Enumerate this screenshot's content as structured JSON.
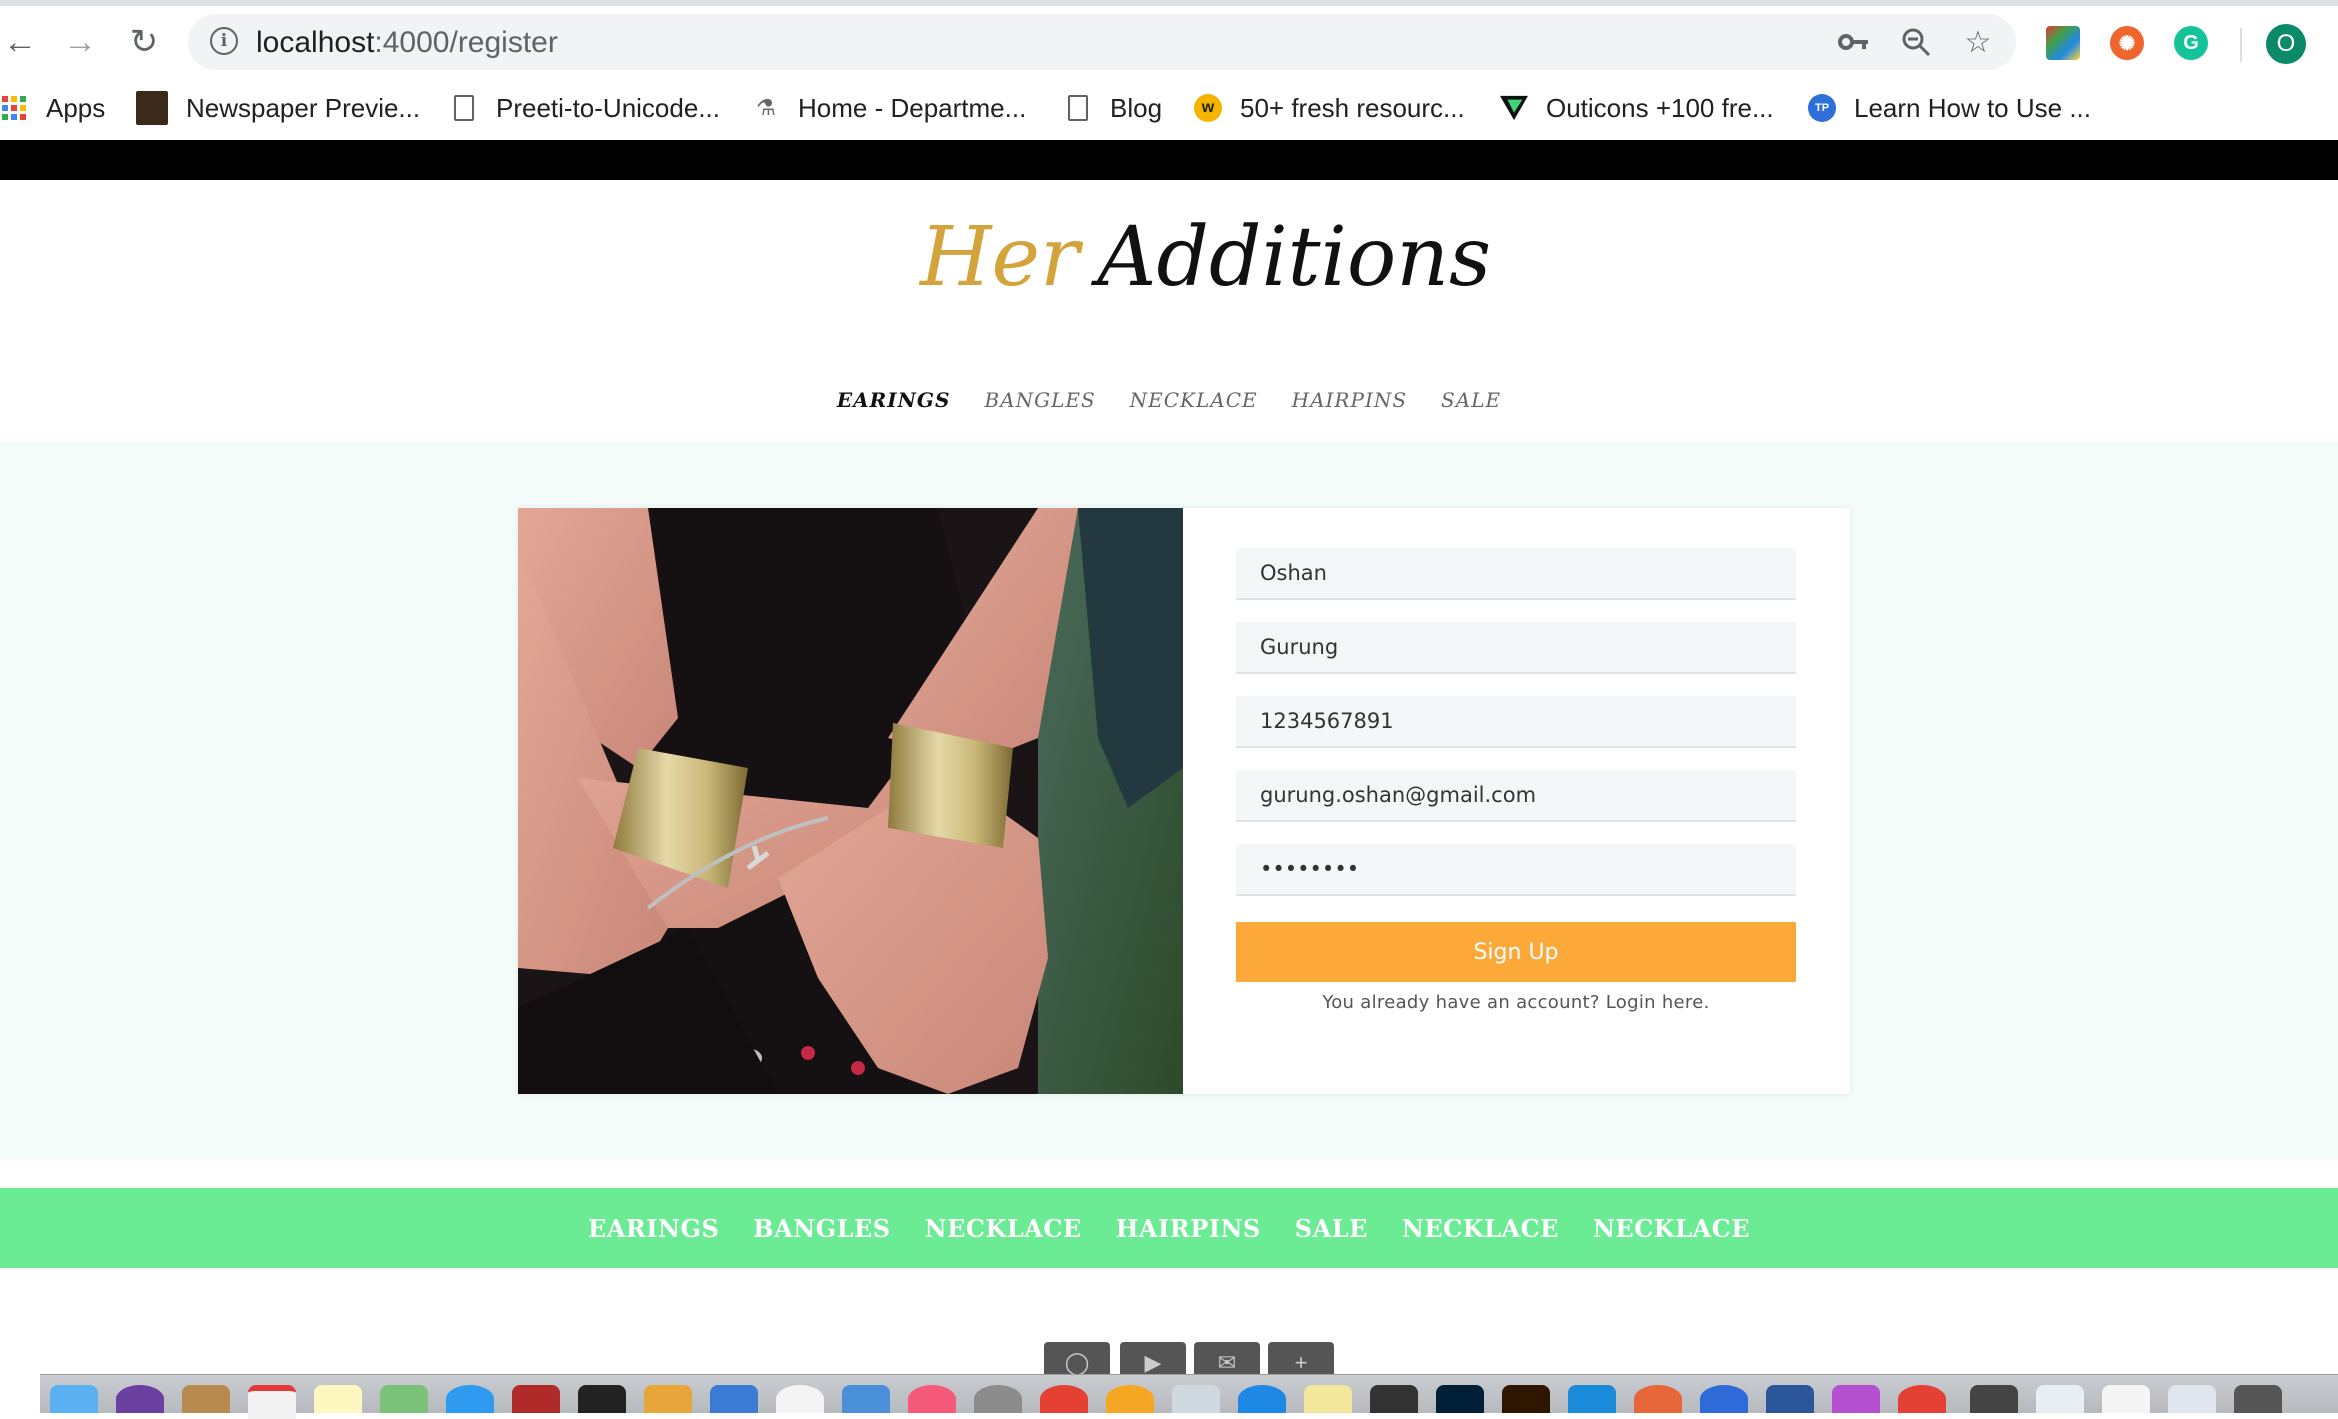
{
  "browser": {
    "url_host": "localhost",
    "url_path": ":4000/register",
    "profile_initial": "O",
    "bookmarks": [
      {
        "label": "Apps",
        "icon": "apps-grid-icon"
      },
      {
        "label": "Newspaper Previe...",
        "icon": "newspaper-icon"
      },
      {
        "label": "Preeti-to-Unicode...",
        "icon": "document-icon"
      },
      {
        "label": "Home - Departme...",
        "icon": "department-icon"
      },
      {
        "label": "Blog",
        "icon": "document-icon"
      },
      {
        "label": "50+ fresh resourc...",
        "icon": "resource-icon"
      },
      {
        "label": "Outicons +100 fre...",
        "icon": "outicons-icon"
      },
      {
        "label": "Learn How to Use ...",
        "icon": "tp-icon"
      }
    ]
  },
  "site": {
    "logo_part1": "Her",
    "logo_part2": "Additions",
    "nav": [
      "EARINGS",
      "BANGLES",
      "NECKLACE",
      "HAIRPINS",
      "SALE"
    ],
    "form": {
      "first_name": "Oshan",
      "last_name": "Gurung",
      "phone": "1234567891",
      "email": "gurung.oshan@gmail.com",
      "password": "••••••••",
      "submit_label": "Sign Up",
      "login_hint": "You already have an account? Login here."
    },
    "footer_nav": [
      "EARINGS",
      "BANGLES",
      "NECKLACE",
      "HAIRPINS",
      "SALE",
      "NECKLACE",
      "NECKLACE"
    ],
    "colors": {
      "accent_gold": "#d4a43c",
      "signup_orange": "#fda93a",
      "footer_green": "#6bec94",
      "content_bg": "#f3fcf8"
    }
  }
}
